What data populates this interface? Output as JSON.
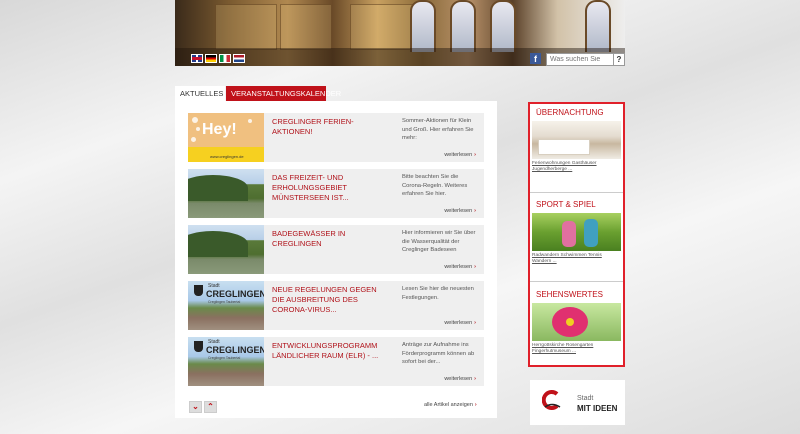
{
  "header": {
    "search_placeholder": "Was suchen Sie",
    "search_button": "?",
    "facebook_label": "f",
    "flags": [
      {
        "name": "flag-uk",
        "colors": [
          "#233c8c",
          "#c8102e"
        ]
      },
      {
        "name": "flag-germany",
        "colors": [
          "#000000",
          "#dd0000",
          "#ffce00"
        ]
      },
      {
        "name": "flag-italy",
        "colors": [
          "#009246",
          "#ffffff",
          "#ce2b37"
        ]
      },
      {
        "name": "flag-netherlands",
        "colors": [
          "#ae1c28",
          "#ffffff",
          "#21468b"
        ]
      }
    ]
  },
  "tabs": {
    "aktuelles": "AKTUELLES",
    "kalender": "Veranstaltungskalender"
  },
  "articles": [
    {
      "title": "CREGLINGER FERIEN-AKTIONEN!",
      "text": "Sommer-Aktionen für Klein und Groß. Hier erfahren Sie mehr:",
      "more": "weiterlesen",
      "thumb": "hey"
    },
    {
      "title": "DAS FREIZEIT- UND ERHOLUNGSGEBIET MÜNSTERSEEN IST...",
      "text": "Bitte beachten Sie die Corona-Regeln. Weiteres erfahren Sie hier.",
      "more": "weiterlesen",
      "thumb": "land"
    },
    {
      "title": "BADEGEWÄSSER IN CREGLINGEN",
      "text": "Hier informieren wir Sie über die Wasserqualität der Creglinger Badeseen",
      "more": "weiterlesen",
      "thumb": "land"
    },
    {
      "title": "NEUE REGELUNGEN GEGEN DIE AUSBREITUNG DES CORONA-VIRUS...",
      "text": "Lesen Sie hier die neuesten Festlegungen.",
      "more": "weiterlesen",
      "thumb": "stadt"
    },
    {
      "title": "ENTWICKLUNGSPROGRAMM LÄNDLICHER RAUM (ELR) - ...",
      "text": "Anträge zur Aufnahme ins Förderprogramm können ab sofort bei der...",
      "more": "weiterlesen",
      "thumb": "stadt"
    }
  ],
  "thumb_text": {
    "hey": "Hey!",
    "hey_small": "www.creglingen.de",
    "stadt_small": "Stadt",
    "stadt_big": "CREGLINGEN",
    "stadt_sub": "Creglingen Taubertal"
  },
  "pagination": {
    "down": "⌄",
    "up": "⌃",
    "all_articles": "alle Artikel anzeigen"
  },
  "sidebar": {
    "sections": [
      {
        "title": "ÜBERNACHTUNG",
        "links": "Ferienwohnungen Gasthäuser Jugendherberge ..."
      },
      {
        "title": "SPORT & SPIEL",
        "links": "Radwandern Schwimmen Tennis Wandern ..."
      },
      {
        "title": "SEHENSWERTES",
        "links": "Herrgottskirche Rosengarten Fingerhutmuseum ..."
      }
    ]
  },
  "logo": {
    "line1": "Stadt",
    "line2": "MIT IDEEN"
  },
  "colors": {
    "accent": "#c0121a",
    "sidebar_border": "#e0202a"
  }
}
